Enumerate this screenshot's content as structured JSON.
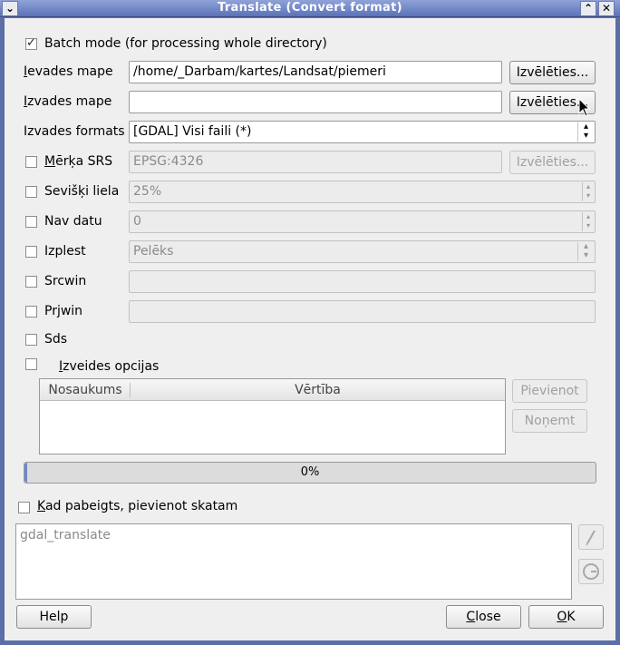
{
  "window": {
    "title": "Translate (Convert format)",
    "menu_icon": "chevron-down-icon",
    "shade_icon": "chevron-up-icon",
    "close_icon": "close-icon"
  },
  "batch_mode": {
    "label": "Batch mode (for processing whole directory)",
    "checked": true
  },
  "input_dir": {
    "label_mnemonic": "I",
    "label_rest": "evades mape",
    "value": "/home/_Darbam/kartes/Landsat/piemeri",
    "browse_label": "Izvēlēties..."
  },
  "output_dir": {
    "label_mnemonic": "I",
    "label_rest": "zvades mape",
    "value": "",
    "browse_label": "Izvēlēties..."
  },
  "output_format": {
    "label": "Izvades formats",
    "value": "[GDAL] Visi faili (*)"
  },
  "target_srs": {
    "label_mnemonic": "M",
    "label_pre": "",
    "label_rest": "ērķa SRS",
    "value": "EPSG:4326",
    "browse_label": "Izvēlēties...",
    "checked": false
  },
  "outsize": {
    "label": "Sevišķi liela",
    "value": "25%",
    "checked": false
  },
  "nodata": {
    "label": "Nav datu",
    "value": "0",
    "checked": false
  },
  "expand": {
    "label": "Izplest",
    "value": "Pelēks",
    "checked": false
  },
  "srcwin": {
    "label": "Srcwin",
    "value": "",
    "checked": false
  },
  "prjwin": {
    "label": "Prjwin",
    "value": "",
    "checked": false
  },
  "sds": {
    "label": "Sds",
    "checked": false
  },
  "creation_options": {
    "label_mnemonic": "I",
    "label_rest": "zveides opcijas",
    "checked": false,
    "columns": [
      "Nosaukums",
      "Vērtība"
    ],
    "add_label": "Pievienot",
    "remove_label": "Noņemt"
  },
  "progress": {
    "value": 0,
    "text": "0%"
  },
  "add_to_canvas": {
    "label_mnemonic": "K",
    "label_rest": "ad pabeigts, pievienot skatam",
    "checked": false
  },
  "command": {
    "text": "gdal_translate",
    "edit_icon": "pencil-icon",
    "reset_icon": "reset-icon"
  },
  "buttons": {
    "help": "Help",
    "close_mnemonic": "C",
    "close_rest": "lose",
    "ok_mnemonic": "O",
    "ok_rest": "K"
  }
}
